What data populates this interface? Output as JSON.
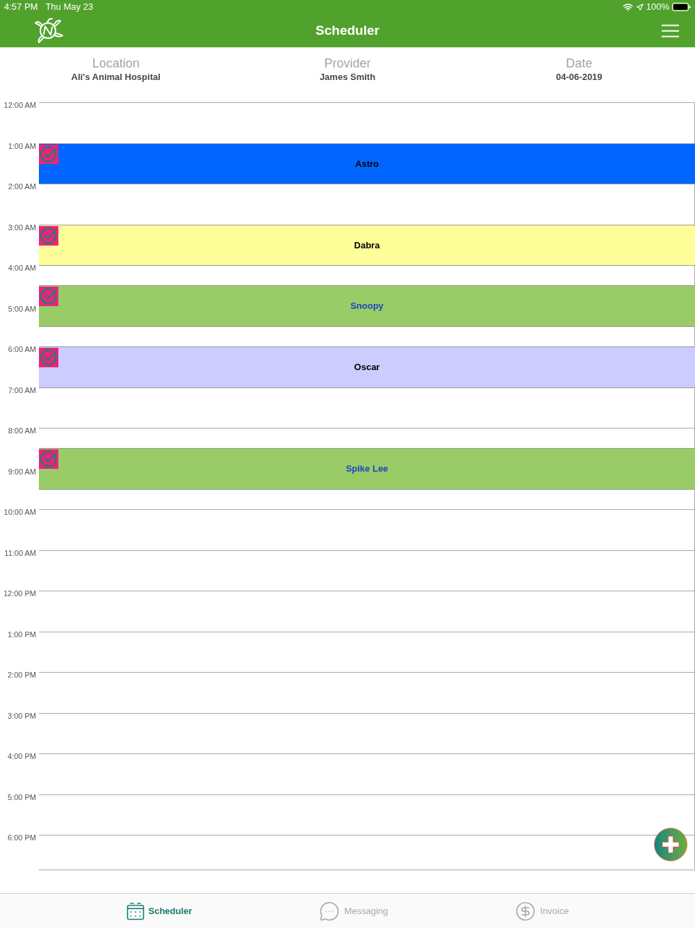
{
  "status_bar": {
    "time": "4:57 PM",
    "date": "Thu May 23",
    "battery": "100%"
  },
  "header": {
    "title": "Scheduler"
  },
  "info": [
    {
      "label": "Location",
      "value": "Ali's Animal Hospital"
    },
    {
      "label": "Provider",
      "value": "James Smith"
    },
    {
      "label": "Date",
      "value": "04-06-2019"
    }
  ],
  "hours": [
    {
      "label": "12:00 AM"
    },
    {
      "label": "1:00 AM",
      "appointment": {
        "title": "Astro",
        "color": "#0066ff",
        "checked": true,
        "linked": false,
        "half_past": false
      }
    },
    {
      "label": "2:00 AM"
    },
    {
      "label": "3:00 AM",
      "appointment": {
        "title": "Dabra",
        "color": "#ffff99",
        "checked": true,
        "linked": false,
        "half_past": false
      }
    },
    {
      "label": "4:00 AM",
      "appointment": {
        "title": "Snoopy",
        "color": "#99cc66",
        "checked": true,
        "linked": true,
        "half_past": true
      }
    },
    {
      "label": "5:00 AM"
    },
    {
      "label": "6:00 AM",
      "appointment": {
        "title": "Oscar",
        "color": "#ccccff",
        "checked": true,
        "linked": false,
        "half_past": false
      }
    },
    {
      "label": "7:00 AM"
    },
    {
      "label": "8:00 AM",
      "appointment": {
        "title": "Spike Lee",
        "color": "#99cc66",
        "checked": true,
        "linked": true,
        "half_past": true
      }
    },
    {
      "label": "9:00 AM"
    },
    {
      "label": "10:00 AM"
    },
    {
      "label": "11:00 AM"
    },
    {
      "label": "12:00 PM"
    },
    {
      "label": "1:00 PM"
    },
    {
      "label": "2:00 PM"
    },
    {
      "label": "3:00 PM"
    },
    {
      "label": "4:00 PM"
    },
    {
      "label": "5:00 PM"
    },
    {
      "label": "6:00 PM"
    }
  ],
  "tabs": [
    {
      "label": "Scheduler",
      "kind": "calendar",
      "selected": true
    },
    {
      "label": "Messaging",
      "kind": "chat",
      "selected": false
    },
    {
      "label": "Invoice",
      "kind": "dollar",
      "selected": false
    }
  ]
}
